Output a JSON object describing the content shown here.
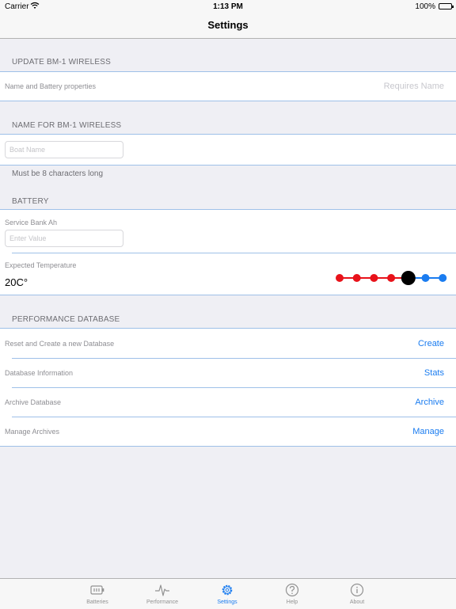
{
  "status_bar": {
    "carrier": "Carrier",
    "time": "1:13 PM",
    "battery": "100%"
  },
  "nav": {
    "title": "Settings"
  },
  "sections": {
    "update": {
      "header": "UPDATE BM-1 WIRELESS",
      "row_label": "Name and Battery properties",
      "row_value": "Requires Name"
    },
    "name": {
      "header": "NAME FOR BM-1 WIRELESS",
      "input_placeholder": "Boat Name",
      "footer": "Must be 8 characters long"
    },
    "battery": {
      "header": "BATTERY",
      "service_bank_label": "Service Bank Ah",
      "service_bank_placeholder": "Enter Value",
      "temperature_label": "Expected Temperature",
      "temperature_value": "20C°",
      "temperature_slider": {
        "steps": 7,
        "selected_index": 4,
        "colors": [
          "#e8121a",
          "#1a7cf0",
          "#000000"
        ]
      }
    },
    "performance": {
      "header": "PERFORMANCE DATABASE",
      "rows": [
        {
          "label": "Reset and Create a new Database",
          "action": "Create"
        },
        {
          "label": "Database Information",
          "action": "Stats"
        },
        {
          "label": "Archive Database",
          "action": "Archive"
        },
        {
          "label": "Manage Archives",
          "action": "Manage"
        }
      ]
    }
  },
  "tabbar": {
    "tabs": [
      {
        "label": "Batteries",
        "icon": "battery-icon"
      },
      {
        "label": "Performance",
        "icon": "pulse-icon"
      },
      {
        "label": "Settings",
        "icon": "gear-icon",
        "active": true
      },
      {
        "label": "Help",
        "icon": "help-icon"
      },
      {
        "label": "About",
        "icon": "info-icon"
      }
    ]
  },
  "colors": {
    "accent": "#1a7cf0",
    "separator": "#9ec0e8"
  }
}
